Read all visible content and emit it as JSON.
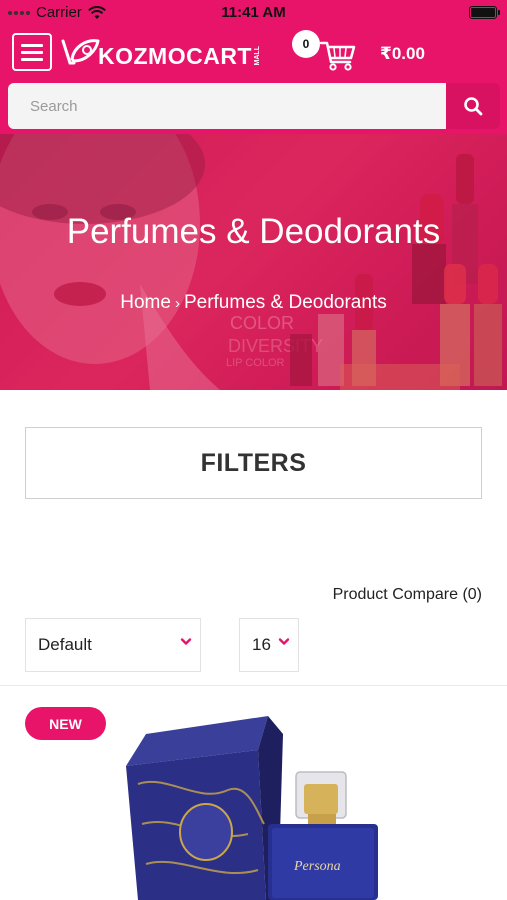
{
  "status_bar": {
    "carrier": "Carrier",
    "time": "11:41 AM",
    "icons": [
      "signal-icon",
      "wifi-icon",
      "battery-icon"
    ]
  },
  "header": {
    "logo_text": "KOZMOCART",
    "logo_sub": "MALL",
    "cart_count": "0",
    "cart_total": "₹0.00",
    "icons": [
      "menu-icon",
      "cart-icon"
    ]
  },
  "search": {
    "placeholder": "Search",
    "icon": "search-icon"
  },
  "banner": {
    "title": "Perfumes & Deodorants",
    "breadcrumb": {
      "home": "Home",
      "separator": "›",
      "current": "Perfumes & Deodorants"
    }
  },
  "filters": {
    "label": "FILTERS"
  },
  "product_compare": {
    "label": "Product Compare (0)"
  },
  "sort_select": {
    "value": "Default"
  },
  "limit_select": {
    "value": "16"
  },
  "product": {
    "badge": "NEW"
  },
  "colors": {
    "brand": "#e8146a",
    "search_button": "#d81260",
    "border": "#cfcfcf"
  }
}
